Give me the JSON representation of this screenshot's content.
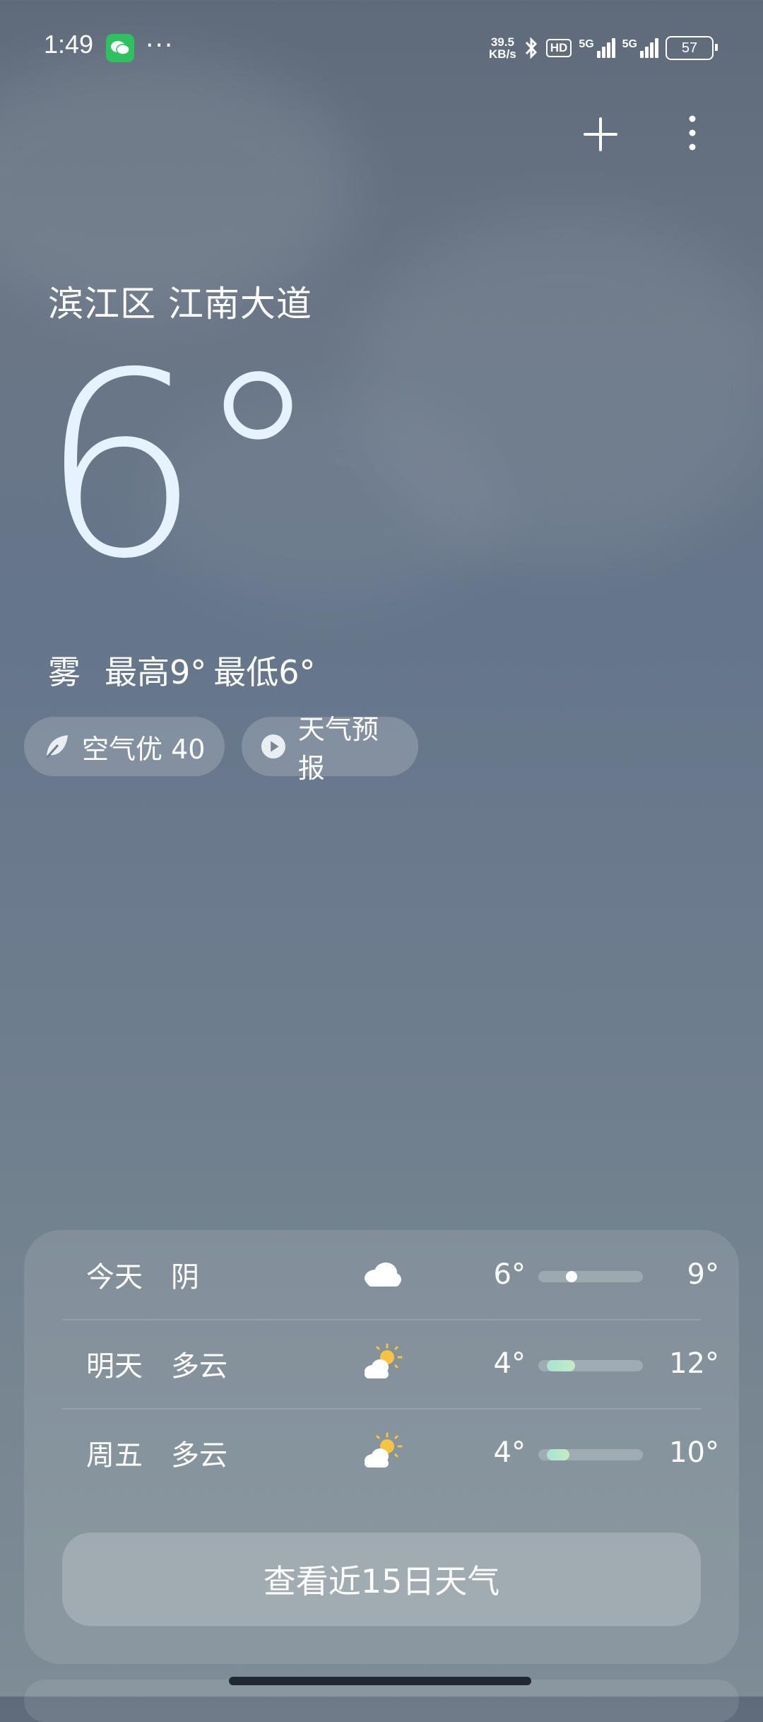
{
  "status": {
    "time": "1:49",
    "speed_top": "39.5",
    "speed_bottom": "KB/s",
    "hd": "HD",
    "net1": "5G",
    "net2": "5G",
    "battery": "57"
  },
  "location": "滨江区 江南大道",
  "current": {
    "temp": "6°",
    "condition": "雾",
    "high": "最高9°",
    "low": "最低6°"
  },
  "chips": {
    "air": "空气优 40",
    "forecast": "天气预报"
  },
  "daily": [
    {
      "day": "今天",
      "weather": "阴",
      "icon": "cloud-icon",
      "low": "6°",
      "high": "9°",
      "bar_start": 0.0,
      "bar_end": 0.6
    },
    {
      "day": "明天",
      "weather": "多云",
      "icon": "partly-sunny-icon",
      "low": "4°",
      "high": "12°",
      "bar_start": 0.08,
      "bar_end": 0.35
    },
    {
      "day": "周五",
      "weather": "多云",
      "icon": "partly-sunny-icon",
      "low": "4°",
      "high": "10°",
      "bar_start": 0.08,
      "bar_end": 0.3
    }
  ],
  "more_button": "查看近15日天气",
  "colors": {
    "bar_fill_start": "#a6e3d4",
    "bar_fill_end": "#c8ecc0",
    "today_dot": "#ffffff"
  }
}
